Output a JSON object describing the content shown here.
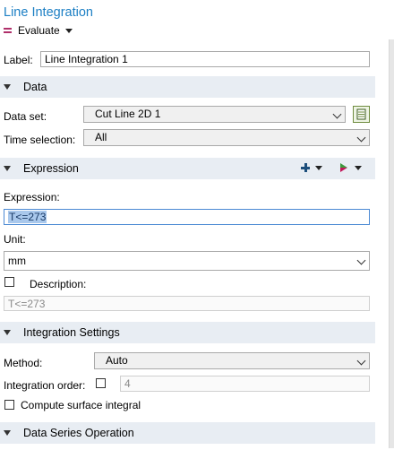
{
  "header": {
    "title": "Line Integration",
    "evaluate_label": "Evaluate"
  },
  "label_row": {
    "label": "Label:",
    "value": "Line Integration 1"
  },
  "data_section": {
    "title": "Data",
    "dataset_label": "Data set:",
    "dataset_value": "Cut Line 2D 1",
    "time_label": "Time selection:",
    "time_value": "All"
  },
  "expression_section": {
    "title": "Expression",
    "expression_label": "Expression:",
    "expression_value": "T<=273",
    "unit_label": "Unit:",
    "unit_value": "mm",
    "description_label": "Description:",
    "description_value": "T<=273"
  },
  "integration_section": {
    "title": "Integration Settings",
    "method_label": "Method:",
    "method_value": "Auto",
    "order_label": "Integration order:",
    "order_value": "4",
    "surface_label": "Compute surface integral"
  },
  "dataseries_section": {
    "title": "Data Series Operation"
  },
  "colors": {
    "title_blue": "#1c7fc4",
    "section_bg": "#e8edf3",
    "evaluate_icon": "#b0306a"
  },
  "icons": [
    "equals-icon",
    "dropdown-caret-icon",
    "chevron-down-icon",
    "plot-dataset-icon",
    "add-icon",
    "replace-expression-icon",
    "collapse-triangle-icon"
  ]
}
